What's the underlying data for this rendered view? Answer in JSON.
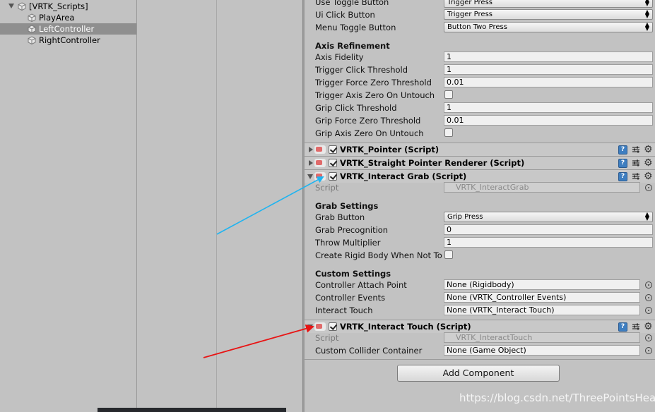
{
  "hierarchy": {
    "root": "[VRTK_Scripts]",
    "items": [
      "PlayArea",
      "LeftController",
      "RightController"
    ]
  },
  "inspector": {
    "dropdown_rows": [
      {
        "label": "Use Toggle Button",
        "value": "Trigger Press"
      },
      {
        "label": "Ui Click Button",
        "value": "Trigger Press"
      },
      {
        "label": "Menu Toggle Button",
        "value": "Button Two Press"
      }
    ],
    "axis_refinement": {
      "title": "Axis Refinement",
      "rows": [
        {
          "label": "Axis Fidelity",
          "value": "1"
        },
        {
          "label": "Trigger Click Threshold",
          "value": "1"
        },
        {
          "label": "Trigger Force Zero Threshold",
          "value": "0.01"
        },
        {
          "label": "Trigger Axis Zero On Untouch",
          "value": ""
        },
        {
          "label": "Grip Click Threshold",
          "value": "1"
        },
        {
          "label": "Grip Force Zero Threshold",
          "value": "0.01"
        },
        {
          "label": "Grip Axis Zero On Untouch",
          "value": ""
        }
      ]
    },
    "components": [
      {
        "title": "VRTK_Pointer (Script)"
      },
      {
        "title": "VRTK_Straight Pointer Renderer (Script)"
      },
      {
        "title": "VRTK_Interact Grab (Script)"
      },
      {
        "title": "VRTK_Interact Touch (Script)"
      }
    ],
    "interact_grab": {
      "script_label": "Script",
      "script_value": "VRTK_InteractGrab",
      "grab_settings_title": "Grab Settings",
      "grab_button_label": "Grab Button",
      "grab_button_value": "Grip Press",
      "grab_precognition_label": "Grab Precognition",
      "grab_precognition_value": "0",
      "throw_multiplier_label": "Throw Multiplier",
      "throw_multiplier_value": "1",
      "create_rigid_label": "Create Rigid Body When Not To",
      "custom_settings_title": "Custom Settings",
      "attach_point_label": "Controller Attach Point",
      "attach_point_value": "None (Rigidbody)",
      "controller_events_label": "Controller Events",
      "controller_events_value": "None (VRTK_Controller Events)",
      "interact_touch_label": "Interact Touch",
      "interact_touch_value": "None (VRTK_Interact Touch)"
    },
    "interact_touch": {
      "script_label": "Script",
      "script_value": "VRTK_InteractTouch",
      "collider_label": "Custom Collider Container",
      "collider_value": "None (Game Object)"
    },
    "add_component": "Add Component",
    "help_glyph": "?"
  },
  "watermark": "https://blog.csdn.net/ThreePointsHeat",
  "colors": {
    "arrow_blue": "#1fb4f0",
    "arrow_red": "#e81414"
  }
}
